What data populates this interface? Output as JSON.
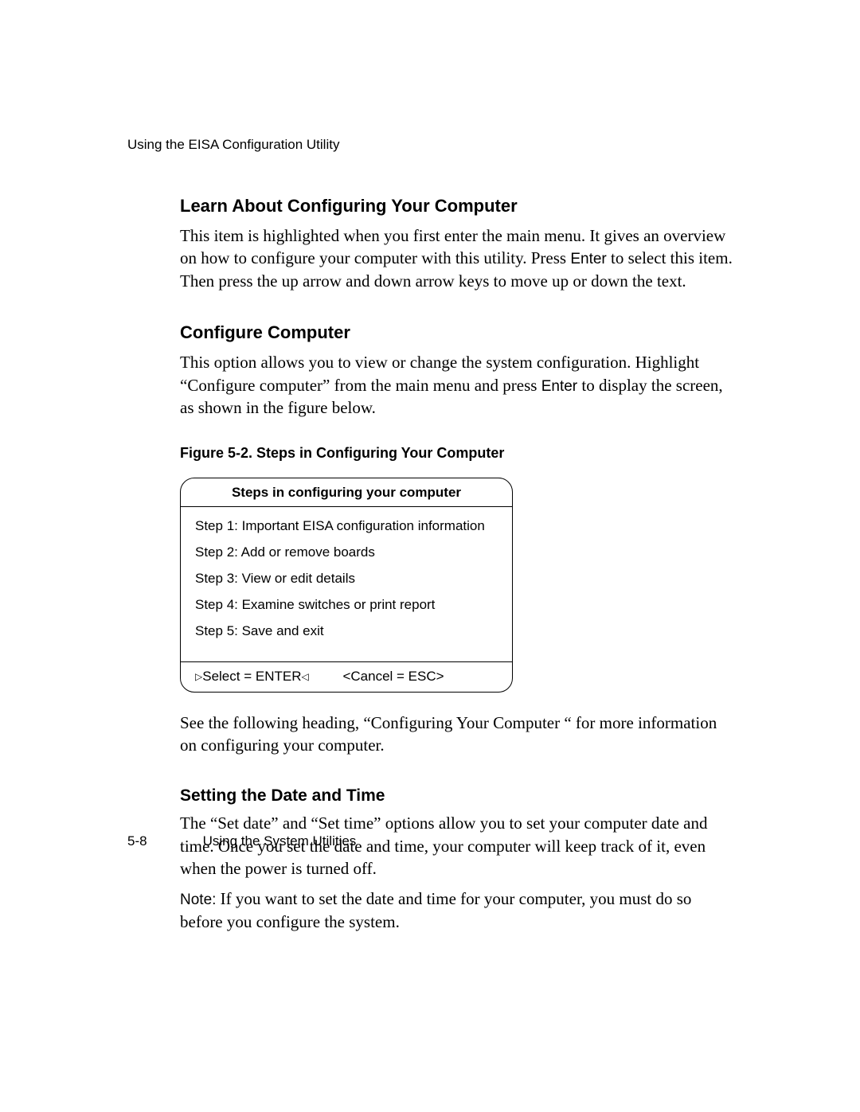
{
  "running_header": "Using the EISA Configuration Utility",
  "section_learn": {
    "heading": "Learn About Configuring Your Computer",
    "para_pre": "This item is highlighted when you first enter the main menu. It gives an overview on how to configure your computer with this utility. Press ",
    "enter_key": "Enter",
    "para_post": " to select this item. Then press the up arrow and down arrow keys to move up or down the text."
  },
  "section_configure": {
    "heading": "Configure Computer",
    "para_pre": "This option allows you to view or change the system configuration. Highlight “Configure computer” from the main menu and press ",
    "enter_key": "Enter",
    "para_post": " to display the screen, as shown in the figure below."
  },
  "figure": {
    "caption": "Figure 5-2.  Steps in Configuring Your Computer",
    "title": "Steps in configuring your computer",
    "steps": [
      "Step 1:  Important EISA configuration information",
      "Step 2:  Add or remove boards",
      "Step 3:  View or edit details",
      "Step 4:  Examine switches or print report",
      "Step 5:  Save and exit"
    ],
    "footer_select": "Select = ENTER",
    "footer_cancel": "<Cancel = ESC>"
  },
  "after_figure_para": "See the following heading, “Configuring Your Computer “ for more information on configuring your computer.",
  "section_date": {
    "heading": "Setting the Date and Time",
    "para": "The “Set date” and “Set time” options allow you to set your computer date and time. Once you set the date and time, your computer will keep track of it, even when the power is turned off.",
    "note_label": "Note:",
    "note_body": "  If you want to set the date and time for your computer, you must do so before you configure the system."
  },
  "footer": {
    "page_num": "5-8",
    "footer_text": "Using the System Utilities"
  }
}
